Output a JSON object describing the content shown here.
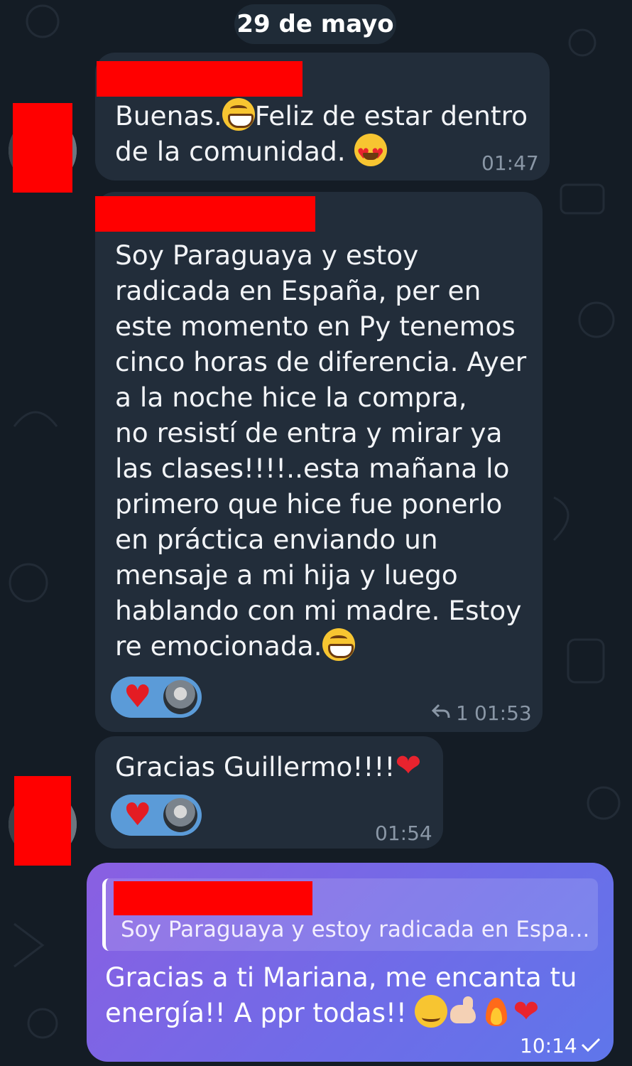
{
  "date_separator": "29 de mayo",
  "messages": [
    {
      "text_line1": "Buenas.",
      "text_line1b": "Feliz de estar dentro",
      "text_line2": "de la comunidad. ",
      "time": "01:47",
      "emojis": [
        "grinning-face",
        "heart-eyes-face"
      ]
    },
    {
      "lines": [
        "Soy Paraguaya y estoy",
        "radicada en España, per en",
        "este momento en Py tenemos",
        "cinco horas de diferencia. Ayer",
        "a la noche hice la compra,",
        "no resistí de entra y mirar ya",
        "las clases!!!!..esta mañana lo",
        "primero que hice fue ponerlo",
        "en práctica enviando un",
        "mensaje a mi hija y luego",
        "hablando con mi madre. Estoy",
        "re emocionada."
      ],
      "reaction": "heart",
      "reply_count": "1",
      "time": "01:53"
    },
    {
      "text": "Gracias Guillermo!!!!",
      "reaction": "heart",
      "time": "01:54"
    }
  ],
  "outgoing": {
    "quote": "Soy Paraguaya y estoy radicada en Espa...",
    "line1": "Gracias a ti Mariana, me encanta tu",
    "line2": "energía!! A ppr todas!! ",
    "time": "10:14",
    "status_icon": "check-icon"
  },
  "colors": {
    "background": "#141c25",
    "incoming_bubble": "#222d3a",
    "outgoing_gradient_start": "#8a5fe2",
    "outgoing_gradient_end": "#5f76ea",
    "reaction_pill": "#5b9bd8",
    "redaction": "#ff0000"
  }
}
